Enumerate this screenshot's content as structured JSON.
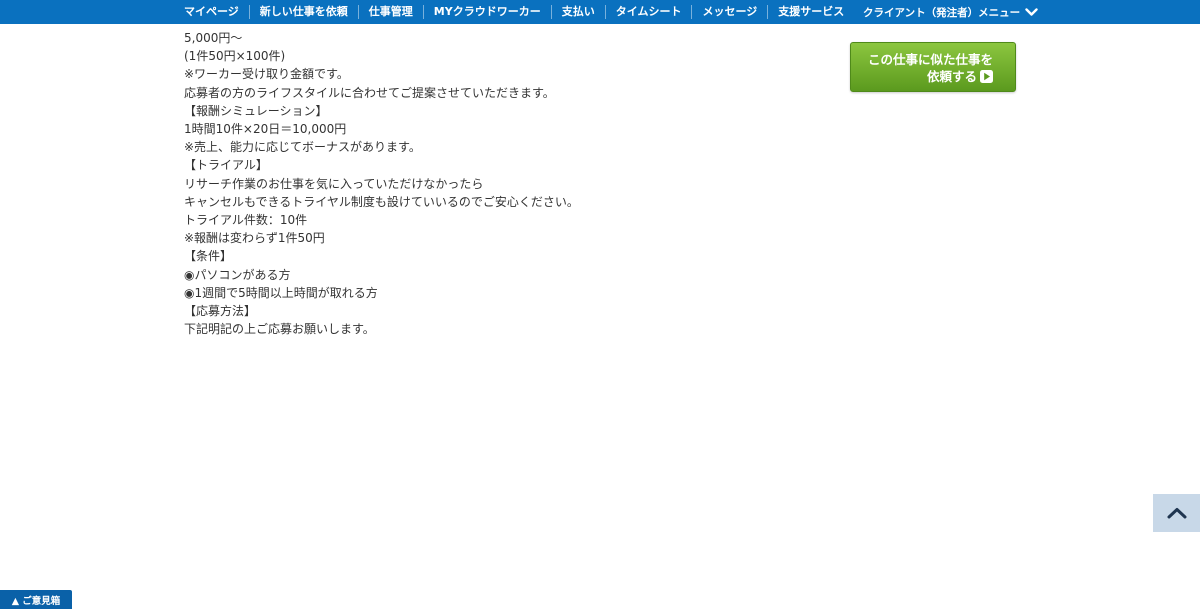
{
  "nav": {
    "items": [
      "マイページ",
      "新しい仕事を依頼",
      "仕事管理",
      "MYクラウドワーカー",
      "支払い",
      "タイムシート",
      "メッセージ",
      "支援サービス"
    ],
    "client_menu": "クライアント（発注者）メニュー",
    "client_menu_icon": "chevron-down-icon"
  },
  "content": {
    "lines": [
      "5,000円〜",
      "(1件50円×100件)",
      "※ワーカー受け取り金額です。",
      "",
      "応募者の方のライフスタイルに合わせてご提案させていただきます。",
      "",
      "",
      "【報酬シミュレーション】",
      "",
      "1時間10件×20日＝10,000円",
      "※売上、能力に応じてボーナスがあります。",
      "",
      "",
      "【トライアル】",
      "",
      "リサーチ作業のお仕事を気に入っていただけなかったら",
      "キャンセルもできるトライヤル制度も設けていいるのでご安心ください。",
      "",
      "トライアル件数：10件",
      "※報酬は変わらず1件50円",
      "",
      "",
      "【条件】",
      "",
      "◉パソコンがある方",
      "◉1週間で5時間以上時間が取れる方",
      "",
      "",
      "【応募方法】",
      "",
      "下記明記の上ご応募お願いします。"
    ]
  },
  "cta": {
    "line1": "この仕事に似た仕事を",
    "line2": "依頼する",
    "icon": "play-icon",
    "color": "#6faf2a"
  },
  "scroll_top": {
    "icon": "chevron-up-icon"
  },
  "feedback": {
    "label": "▲ ご意見箱"
  },
  "colors": {
    "header": "#0a71bf",
    "accent_green": "#6faf2a"
  }
}
